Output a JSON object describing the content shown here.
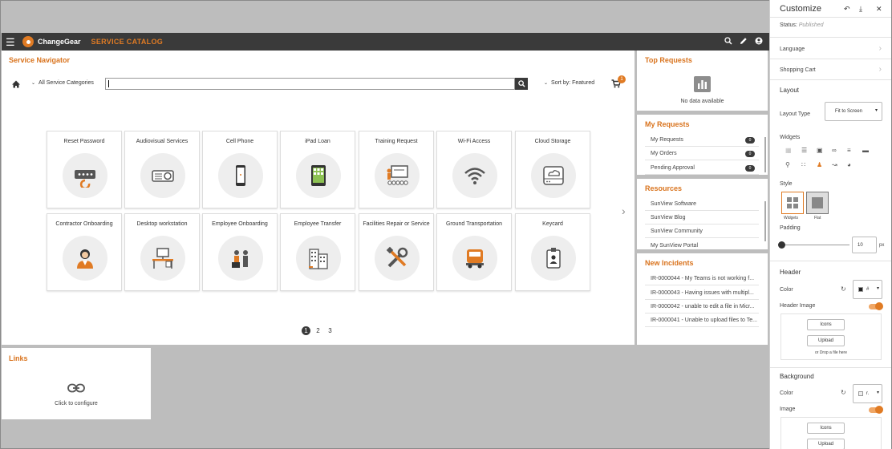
{
  "app": {
    "brand": "ChangeGear",
    "section": "SERVICE CATALOG"
  },
  "navigator": {
    "title": "Service Navigator",
    "categories": "All Service Categories",
    "search_value": "",
    "sort": "Sort by: Featured",
    "cart_count": "1",
    "tiles": [
      {
        "label": "Reset Password",
        "icon": "password-icon"
      },
      {
        "label": "Audiovisual Services",
        "icon": "projector-icon"
      },
      {
        "label": "Cell Phone",
        "icon": "phone-icon"
      },
      {
        "label": "iPad Loan",
        "icon": "tablet-icon"
      },
      {
        "label": "Training Request",
        "icon": "training-icon"
      },
      {
        "label": "Wi-Fi Access",
        "icon": "wifi-icon"
      },
      {
        "label": "Cloud Storage",
        "icon": "cloud-storage-icon"
      },
      {
        "label": "Contractor Onboarding",
        "icon": "contractor-icon"
      },
      {
        "label": "Desktop workstation",
        "icon": "desktop-icon"
      },
      {
        "label": "Employee Onboarding",
        "icon": "onboarding-icon"
      },
      {
        "label": "Employee Transfer",
        "icon": "buildings-icon"
      },
      {
        "label": "Facilities Repair or Service",
        "icon": "tools-icon"
      },
      {
        "label": "Ground Transportation",
        "icon": "truck-icon"
      },
      {
        "label": "Keycard",
        "icon": "keycard-icon"
      }
    ],
    "pages": [
      "1",
      "2",
      "3"
    ],
    "active_page": "1"
  },
  "top_requests": {
    "title": "Top Requests",
    "empty": "No data available"
  },
  "my_requests": {
    "title": "My Requests",
    "items": [
      {
        "label": "My Requests",
        "count": "0"
      },
      {
        "label": "My Orders",
        "count": "0"
      },
      {
        "label": "Pending Approval",
        "count": "0"
      }
    ]
  },
  "resources": {
    "title": "Resources",
    "items": [
      "SunView Software",
      "SunView Blog",
      "SunView Community",
      "My SunView Portal"
    ]
  },
  "new_incidents": {
    "title": "New Incidents",
    "items": [
      "IR-0000044 - My Teams is not working f...",
      "IR-0000043 - Having issues with multipl...",
      "IR-0000042 - unable to edit a file in Micr...",
      "IR-0000041 - Unable to upload files to Te..."
    ]
  },
  "links": {
    "title": "Links",
    "hint": "Click to configure"
  },
  "customize": {
    "title": "Customize",
    "status_label": "Status:",
    "status_value": "Published",
    "language": "Language",
    "shopping_cart": "Shopping Cart",
    "layout": {
      "heading": "Layout",
      "type_label": "Layout Type",
      "type_value": "Fit to Screen",
      "widgets_label": "Widgets",
      "style_label": "Style",
      "style_options": [
        "Widgets",
        "Flat"
      ],
      "padding_label": "Padding",
      "padding_value": "10",
      "padding_unit": "px"
    },
    "header": {
      "heading": "Header",
      "color_label": "Color",
      "color_value": "#",
      "image_label": "Header Image",
      "icons_btn": "Icons",
      "upload_btn": "Upload",
      "drop_hint": "or Drop a file here"
    },
    "background": {
      "heading": "Background",
      "color_label": "Color",
      "color_value": "r.",
      "image_label": "Image",
      "icons_btn": "Icons",
      "upload_btn": "Upload"
    }
  },
  "colors": {
    "accent": "#e07b24",
    "dark": "#3a3a3a",
    "backdrop": "#bdbdbd"
  }
}
